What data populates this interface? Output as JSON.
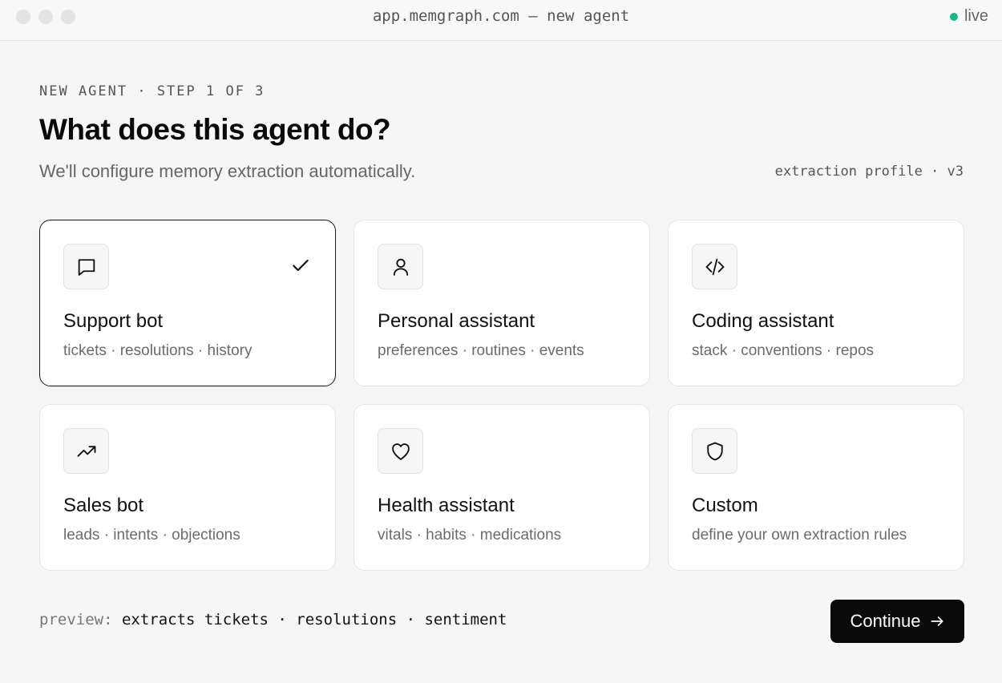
{
  "window": {
    "url": "app.memgraph.com — new agent",
    "status": "live",
    "status_color": "#10b981"
  },
  "header": {
    "eyebrow": "NEW AGENT · STEP 1 OF 3",
    "title": "What does this agent do?",
    "subtitle": "We'll configure memory extraction automatically.",
    "profile": "extraction profile · v3"
  },
  "cards": [
    {
      "icon": "chat-bubble-icon",
      "title": "Support bot",
      "desc": "tickets · resolutions · history",
      "selected": true
    },
    {
      "icon": "user-icon",
      "title": "Personal assistant",
      "desc": "preferences · routines · events",
      "selected": false
    },
    {
      "icon": "code-icon",
      "title": "Coding assistant",
      "desc": "stack · conventions · repos",
      "selected": false
    },
    {
      "icon": "trending-up-icon",
      "title": "Sales bot",
      "desc": "leads · intents · objections",
      "selected": false
    },
    {
      "icon": "heart-icon",
      "title": "Health assistant",
      "desc": "vitals · habits · medications",
      "selected": false
    },
    {
      "icon": "shield-icon",
      "title": "Custom",
      "desc": "define your own extraction rules",
      "selected": false
    }
  ],
  "footer": {
    "preview_label": "preview:",
    "preview_value": "extracts tickets · resolutions · sentiment",
    "continue_label": "Continue"
  }
}
